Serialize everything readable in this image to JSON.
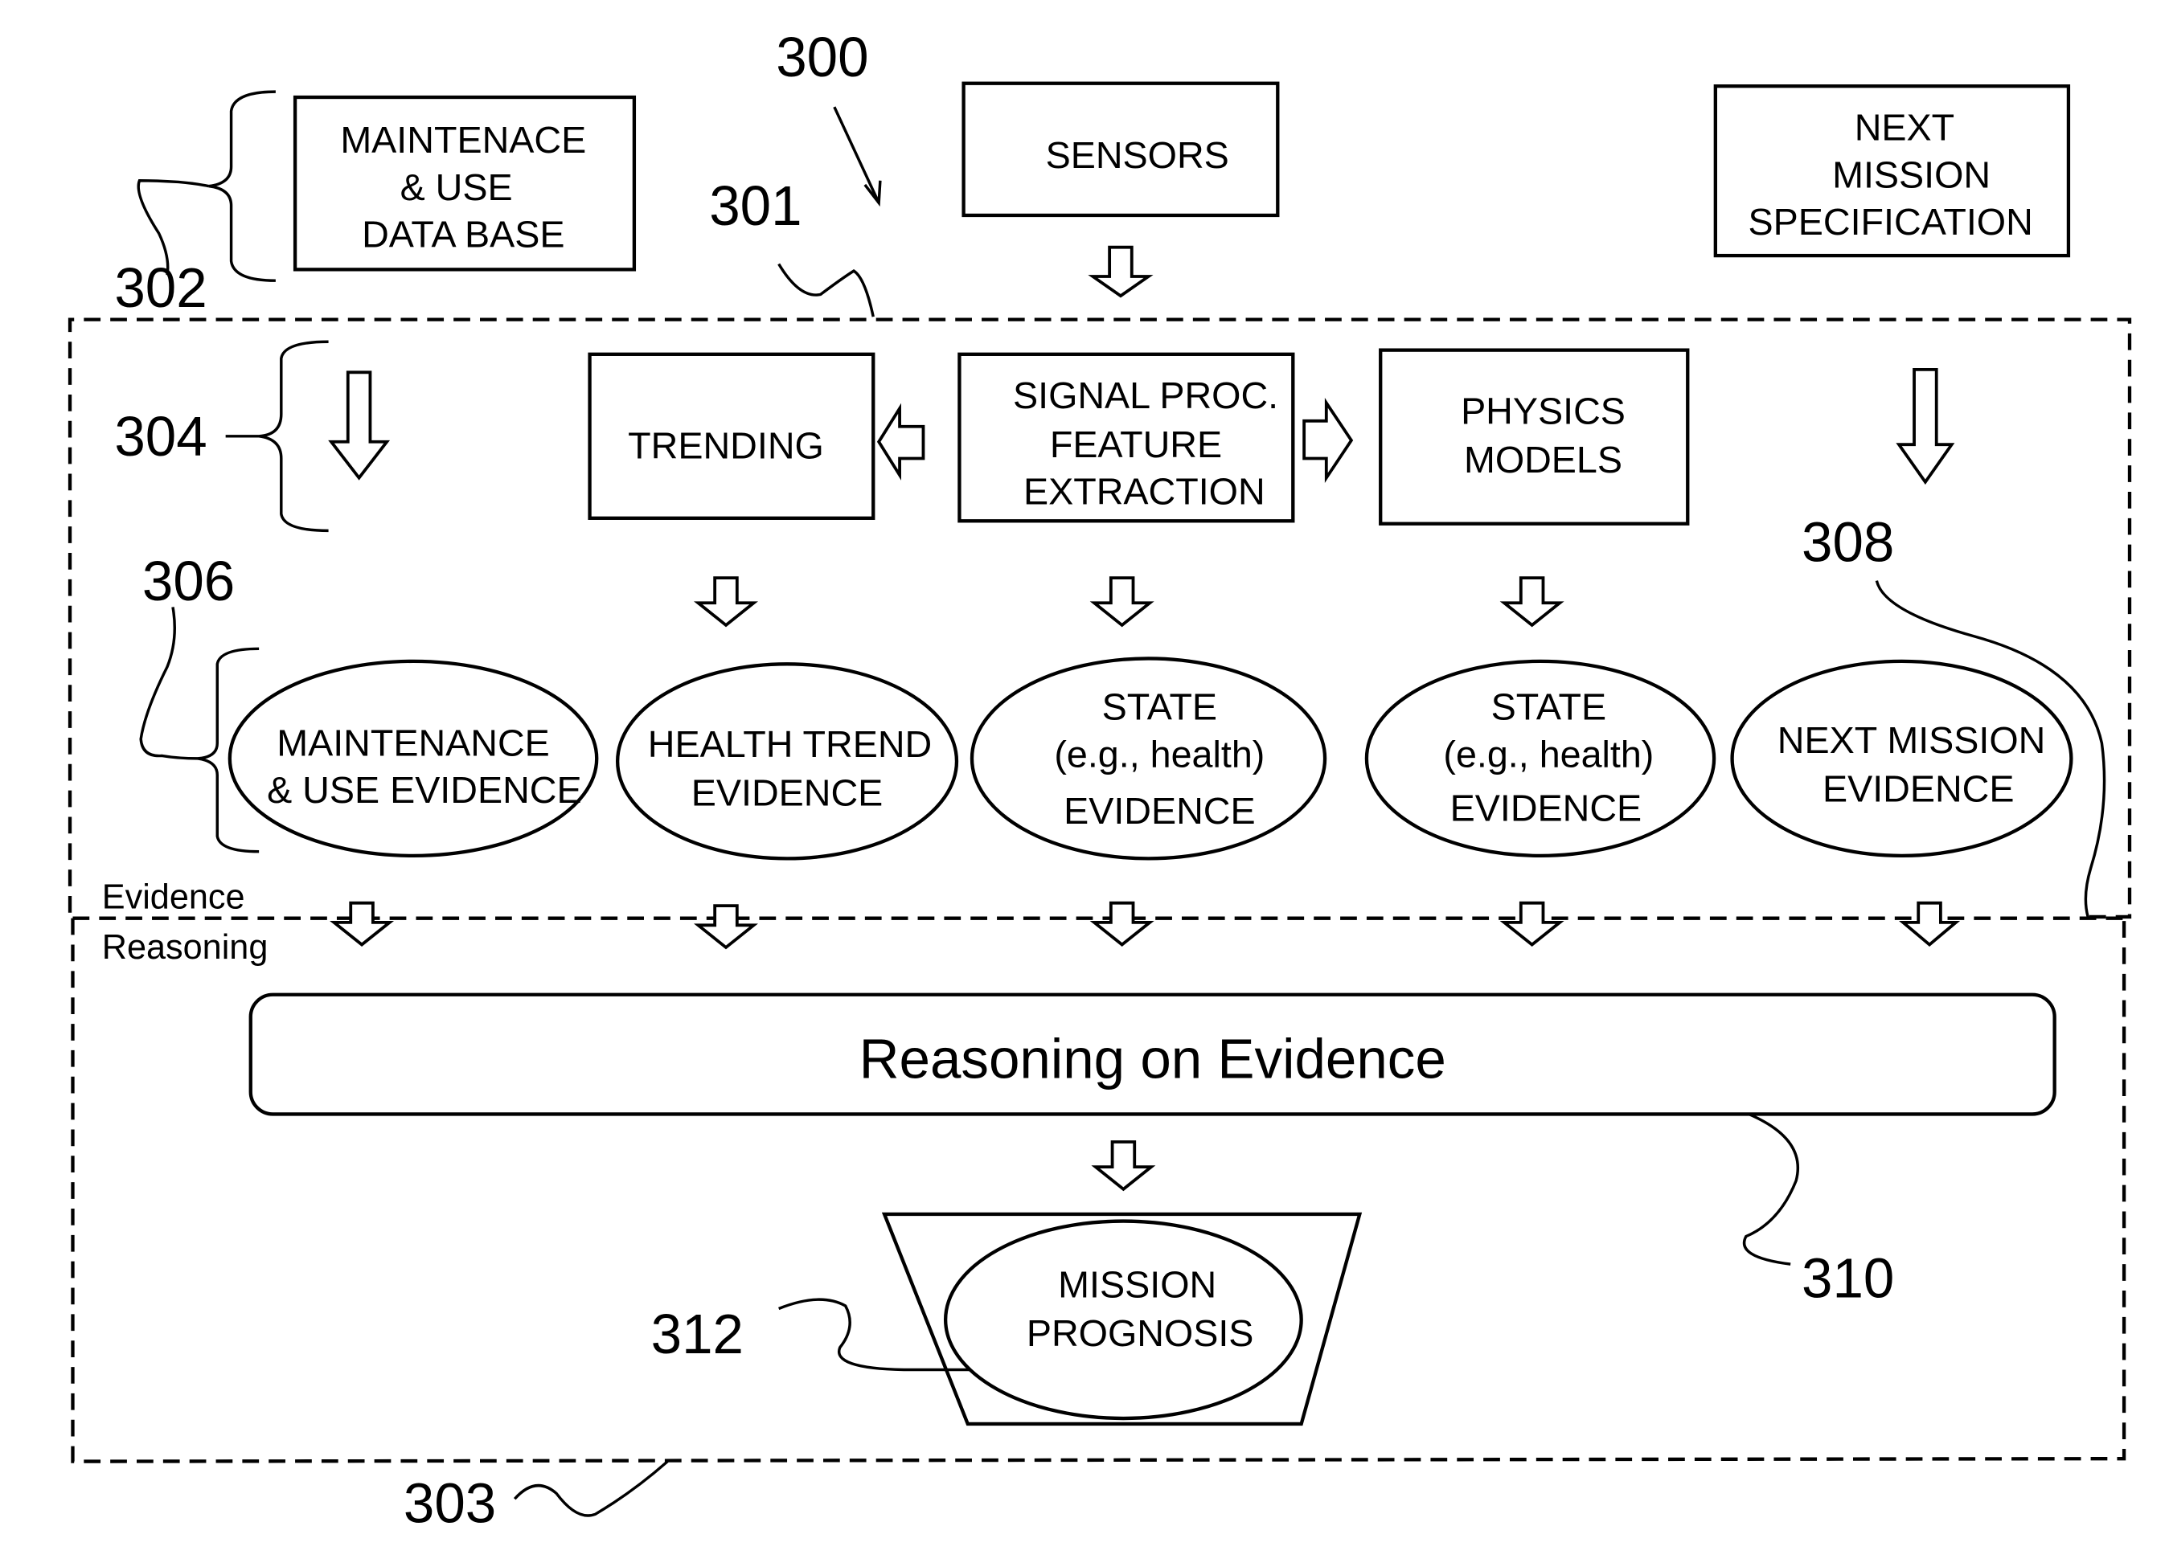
{
  "figure": {
    "ref_numbers": {
      "system": "300",
      "upper_region": "301",
      "inputs_group": "302",
      "lower_region": "303",
      "processing_group": "304",
      "evidence_group": "306",
      "evidence_label": "308",
      "reasoning_label": "310",
      "prognosis_label": "312"
    },
    "inputs": {
      "maintenance_db": [
        "MAINTENACE",
        "& USE",
        "DATA BASE"
      ],
      "sensors": [
        "SENSORS"
      ],
      "next_mission_spec": [
        "NEXT",
        "MISSION",
        "SPECIFICATION"
      ]
    },
    "processing": {
      "trending": [
        "TRENDING"
      ],
      "signal_proc": [
        "SIGNAL PROC.",
        "FEATURE",
        "EXTRACTION"
      ],
      "physics_models": [
        "PHYSICS",
        "MODELS"
      ]
    },
    "evidence": [
      [
        "MAINTENANCE",
        "& USE EVIDENCE"
      ],
      [
        "HEALTH TREND",
        "EVIDENCE"
      ],
      [
        "STATE",
        "(e.g., health)",
        "EVIDENCE"
      ],
      [
        "STATE",
        "(e.g., health)",
        "EVIDENCE"
      ],
      [
        "NEXT MISSION",
        "EVIDENCE"
      ]
    ],
    "region_labels": {
      "top": "Evidence",
      "bottom": "Reasoning"
    },
    "reasoning_box": "Reasoning on Evidence",
    "prognosis": [
      "MISSION",
      "PROGNOSIS"
    ]
  }
}
